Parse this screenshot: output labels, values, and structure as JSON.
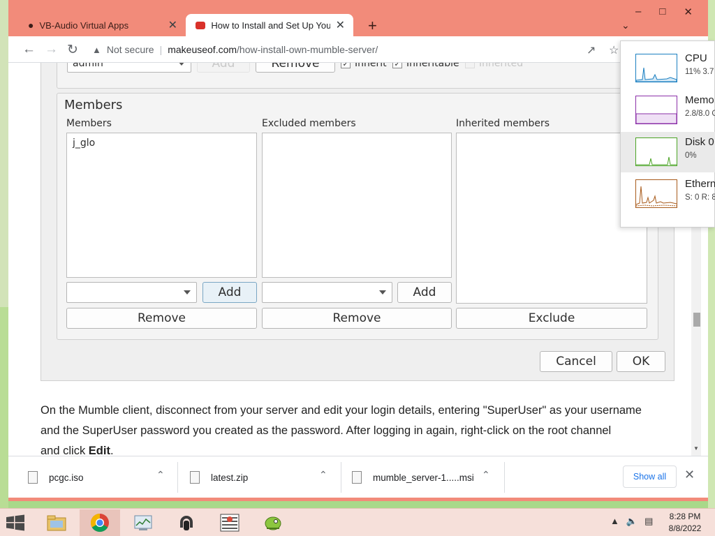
{
  "browser": {
    "tabs": [
      {
        "title": "VB-Audio Virtual Apps",
        "active": false
      },
      {
        "title": "How to Install and Set Up Your O",
        "active": true
      }
    ],
    "new_tab": "+",
    "controls": {
      "minimize": "–",
      "maximize": "□",
      "close": "✕"
    },
    "address": {
      "security": "Not secure",
      "separator": "|",
      "domain": "makeuseof.com",
      "path": "/how-install-own-mumble-server/"
    }
  },
  "dialog": {
    "top_row": {
      "combo_value": "admin",
      "add_label": "Add",
      "remove_label": "Remove",
      "inherit_label": "Inherit",
      "inheritable_label": "Inheritable",
      "inherited_label": "Inherited"
    },
    "members_group": {
      "title": "Members",
      "columns": {
        "members": "Members",
        "excluded": "Excluded members",
        "inherited": "Inherited members"
      },
      "members_list": [
        "j_glo"
      ],
      "add_label": "Add",
      "remove_label": "Remove",
      "exclude_label": "Exclude"
    },
    "cancel_label": "Cancel",
    "ok_label": "OK"
  },
  "article": {
    "line1": "On the Mumble client, disconnect from your server and edit your login details, entering \"SuperUser\" as your username",
    "line2": "and the SuperUser password you created as the password. After logging in again, right-click on the root channel",
    "line3_prefix": "and click ",
    "line3_bold": "Edit",
    "line3_suffix": "."
  },
  "task_manager": [
    {
      "name": "CPU",
      "value": "11%  3.7",
      "color": "#1a7fc1"
    },
    {
      "name": "Memo",
      "value": "2.8/8.0 G",
      "color": "#8b2fa8"
    },
    {
      "name": "Disk 0",
      "value": "0%",
      "color": "#4aa324"
    },
    {
      "name": "Ethern",
      "value": "S: 0  R: 8",
      "color": "#a85a1a"
    }
  ],
  "downloads": {
    "items": [
      {
        "name": "pcgc.iso"
      },
      {
        "name": "latest.zip"
      },
      {
        "name": "mumble_server-1.....msi"
      }
    ],
    "show_all": "Show all"
  },
  "taskbar": {
    "time": "8:28 PM",
    "date": "8/8/2022"
  }
}
